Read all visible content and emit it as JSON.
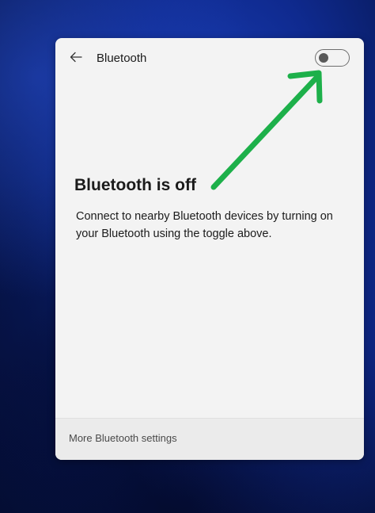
{
  "panel": {
    "title": "Bluetooth",
    "toggle_state": "off",
    "heading": "Bluetooth is off",
    "description": "Connect to nearby Bluetooth devices by turning on your Bluetooth using the toggle above.",
    "footer_link": "More Bluetooth settings"
  },
  "annotation": {
    "arrow_color": "#1db04a"
  },
  "icons": {
    "back": "back-arrow-icon"
  }
}
